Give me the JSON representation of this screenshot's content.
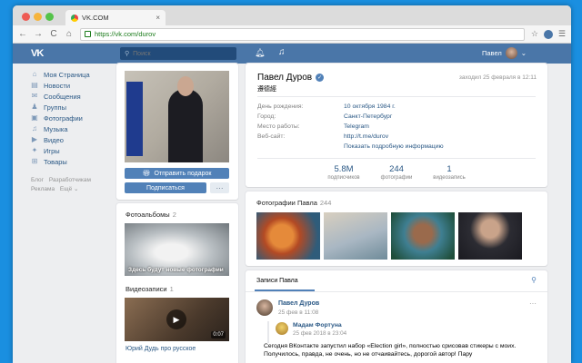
{
  "browser": {
    "tab_title": "VK.COM",
    "tab_close": "×",
    "url": "https://vk.com/durov",
    "back": "←",
    "forward": "→",
    "reload": "C",
    "home": "⌂",
    "star": "☆",
    "menu": "☰",
    "lights": [
      "#ee5b54",
      "#f6b43b",
      "#55c34a"
    ]
  },
  "header": {
    "logo": "VK",
    "search_placeholder": "Поиск",
    "user_name": "Павел",
    "accent": "#4a76a8"
  },
  "left_menu": {
    "items": [
      {
        "label": "Моя Страница",
        "icon": "⌂"
      },
      {
        "label": "Новости",
        "icon": "▤"
      },
      {
        "label": "Сообщения",
        "icon": "✉"
      },
      {
        "label": "Группы",
        "icon": "♟"
      },
      {
        "label": "Фотографии",
        "icon": "▣"
      },
      {
        "label": "Музыка",
        "icon": "♫"
      },
      {
        "label": "Видео",
        "icon": "▶"
      },
      {
        "label": "Игры",
        "icon": "✦"
      },
      {
        "label": "Товары",
        "icon": "⊞"
      }
    ],
    "footer": [
      "Блог",
      "Разработчикам",
      "Реклама",
      "Ещё ⌄"
    ]
  },
  "avatar_card": {
    "gift_button": "Отправить подарок",
    "follow_button": "Подписаться",
    "more_button": "···"
  },
  "albums": {
    "title": "Фотоальбомы",
    "count": "2",
    "caption": "Здесь будут новые фотографии",
    "video_title": "Видеозаписи",
    "video_count": "1",
    "video_duration": "0:07",
    "video_caption": "Юрий Дудь про русское"
  },
  "profile": {
    "name": "Павел Дуров",
    "status": "遵德經",
    "last_seen": "заходил 25 февраля в 12:11",
    "rows": [
      {
        "label": "День рождения:",
        "value": "10 октября 1984 г."
      },
      {
        "label": "Город:",
        "value": "Санкт-Петербург"
      },
      {
        "label": "Место работы:",
        "value": "Telegram"
      },
      {
        "label": "Веб-сайт:",
        "value": "http://t.me/durov"
      }
    ],
    "details_link": "Показать подробную информацию",
    "counters": [
      {
        "num": "5.8M",
        "cap": "подписчиков"
      },
      {
        "num": "244",
        "cap": "фотографии"
      },
      {
        "num": "1",
        "cap": "видеозапись"
      }
    ]
  },
  "photos": {
    "title": "Фотографии Павла",
    "count": "244"
  },
  "wall": {
    "tab": "Записи Павла",
    "post_author": "Павел Дуров",
    "post_date": "25 фев в 11:08",
    "post_menu": "···",
    "repost_author": "Мадам Фортуна",
    "repost_date": "25 фев 2018 в 23:04",
    "text": "Сегодня ВКонтакте запустил набор «Election girl», полностью срисовав стикеры с моих. Получилось, правда, не очень, но не отчаивайтесь, дорогой автор! Пару"
  }
}
